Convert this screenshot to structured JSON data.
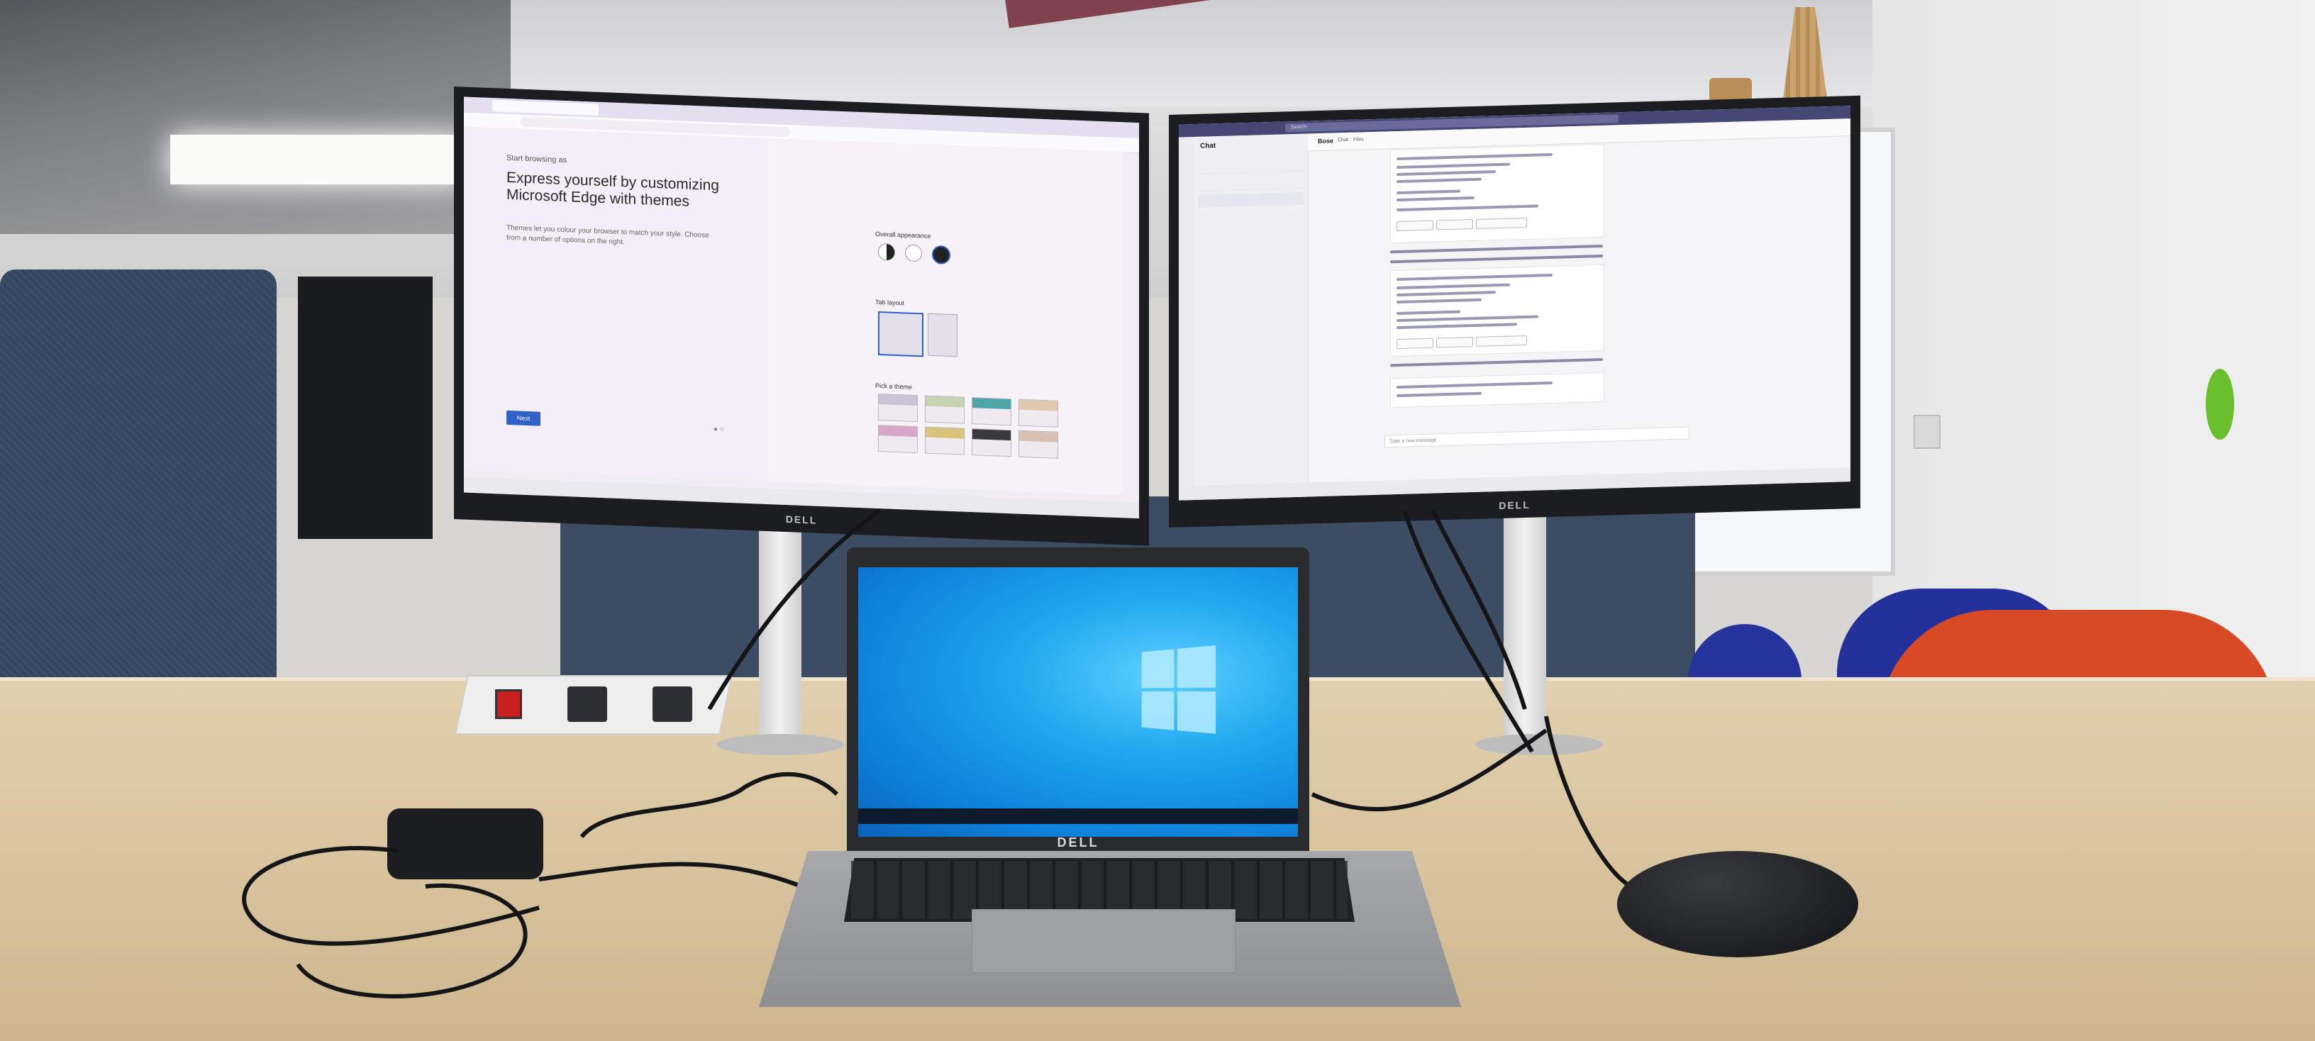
{
  "scene": {
    "description_tags": [
      "office-desk",
      "dual-monitor",
      "laptop",
      "mouse",
      "power-strip"
    ]
  },
  "left_monitor": {
    "brand": "DELL",
    "browser": {
      "tabs": [
        "",
        "",
        ""
      ],
      "address": "",
      "kicker": "Start browsing as",
      "heading": "Express yourself by customizing Microsoft Edge with themes",
      "description": "Themes let you colour your browser to match your style. Choose from a number of options on the right.",
      "next_button": "Next",
      "overall_appearance_label": "Overall appearance",
      "appearance_options": [
        "",
        "",
        ""
      ],
      "tab_layout_label": "Tab layout",
      "theme_label": "Pick a theme",
      "themes": [
        {
          "color": "#c9c3d4"
        },
        {
          "color": "#c6d2b0"
        },
        {
          "color": "#4fa6a8"
        },
        {
          "color": "#e0c9b0"
        },
        {
          "color": "#d8a6c6"
        },
        {
          "color": "#d9c27a"
        },
        {
          "color": "#3a3a3e"
        },
        {
          "color": "#d8c0b4"
        }
      ]
    }
  },
  "right_monitor": {
    "brand": "DELL",
    "teams": {
      "search_placeholder": "Search",
      "panel_title": "Chat",
      "chat_name": "Bose",
      "tabs": [
        "Chat",
        "Files"
      ],
      "compose_placeholder": "Type a new message"
    }
  },
  "laptop": {
    "brand": "DELL"
  },
  "colors": {
    "desk": "#d8c49e",
    "partition": "#3a4d66",
    "chair_orange": "#d84a26",
    "chair_blue": "#24319a",
    "desktop_blue": "#1ea7ef",
    "power_switch": "#c81f1f"
  }
}
